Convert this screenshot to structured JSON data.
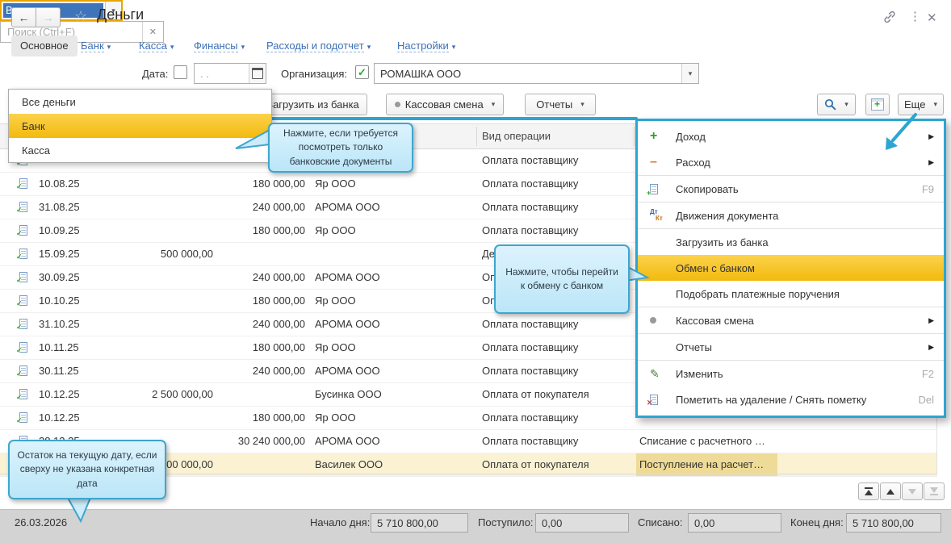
{
  "window": {
    "title": "Деньги"
  },
  "tabs": {
    "active": "Основное",
    "links": [
      "Банк",
      "Касса",
      "Финансы",
      "Расходы и подотчет",
      "Настройки"
    ]
  },
  "filters": {
    "money_value": "Все деньги",
    "date_label": "Дата:",
    "date_placeholder": ". .",
    "org_label": "Организация:",
    "org_value": "РОМАШКА ООО"
  },
  "toolbar": {
    "load_bank": "Загрузить из банка",
    "cash_shift": "Кассовая смена",
    "reports": "Отчеты",
    "search_placeholder": "Поиск (Ctrl+F)",
    "more": "Еще"
  },
  "dropdown": {
    "items": [
      {
        "label": "Все деньги",
        "highlighted": false
      },
      {
        "label": "Банк",
        "highlighted": true
      },
      {
        "label": "Касса",
        "highlighted": false
      }
    ]
  },
  "table": {
    "op_header": "Вид операции",
    "rows": [
      {
        "date": "",
        "income": "",
        "expense": "",
        "party": "",
        "op": "Оплата поставщику",
        "doc": "",
        "posted": true,
        "selected": false
      },
      {
        "date": "10.08.25",
        "income": "",
        "expense": "180 000,00",
        "party": "Яр ООО",
        "op": "Оплата поставщику",
        "doc": "",
        "posted": true,
        "selected": false
      },
      {
        "date": "31.08.25",
        "income": "",
        "expense": "240 000,00",
        "party": "АРОМА ООО",
        "op": "Оплата поставщику",
        "doc": "",
        "posted": true,
        "selected": false
      },
      {
        "date": "10.09.25",
        "income": "",
        "expense": "180 000,00",
        "party": "Яр ООО",
        "op": "Оплата поставщику",
        "doc": "",
        "posted": true,
        "selected": false
      },
      {
        "date": "15.09.25",
        "income": "500 000,00",
        "expense": "",
        "party": "",
        "op": "Де",
        "doc": "",
        "posted": true,
        "selected": false
      },
      {
        "date": "30.09.25",
        "income": "",
        "expense": "240 000,00",
        "party": "АРОМА ООО",
        "op": "Оплата поставщику",
        "doc": "",
        "posted": true,
        "selected": false
      },
      {
        "date": "10.10.25",
        "income": "",
        "expense": "180 000,00",
        "party": "Яр ООО",
        "op": "Оплата поставщику",
        "doc": "",
        "posted": true,
        "selected": false
      },
      {
        "date": "31.10.25",
        "income": "",
        "expense": "240 000,00",
        "party": "АРОМА ООО",
        "op": "Оплата поставщику",
        "doc": "",
        "posted": true,
        "selected": false
      },
      {
        "date": "10.11.25",
        "income": "",
        "expense": "180 000,00",
        "party": "Яр ООО",
        "op": "Оплата поставщику",
        "doc": "",
        "posted": true,
        "selected": false
      },
      {
        "date": "30.11.25",
        "income": "",
        "expense": "240 000,00",
        "party": "АРОМА ООО",
        "op": "Оплата поставщику",
        "doc": "",
        "posted": true,
        "selected": false
      },
      {
        "date": "10.12.25",
        "income": "2 500 000,00",
        "expense": "",
        "party": "Бусинка ООО",
        "op": "Оплата от покупателя",
        "doc": "",
        "posted": true,
        "selected": false
      },
      {
        "date": "10.12.25",
        "income": "",
        "expense": "180 000,00",
        "party": "Яр ООО",
        "op": "Оплата поставщику",
        "doc": "",
        "posted": true,
        "selected": false
      },
      {
        "date": "28.12.25",
        "income": "",
        "expense": "30 240 000,00",
        "party": "АРОМА ООО",
        "op": "Оплата поставщику",
        "doc": "Списание с расчетного …",
        "posted": true,
        "selected": false
      },
      {
        "date": "",
        "income": "700 000,00",
        "expense": "",
        "party": "Василек ООО",
        "op": "Оплата от покупателя",
        "doc": "Поступление на расчет…",
        "posted": false,
        "selected": true
      }
    ]
  },
  "more_menu": {
    "items": [
      {
        "label": "Доход",
        "icon": "plus-icon",
        "submenu": true
      },
      {
        "label": "Расход",
        "icon": "minus-icon",
        "submenu": true
      },
      {
        "sep": true
      },
      {
        "label": "Скопировать",
        "icon": "copy-icon",
        "shortcut": "F9"
      },
      {
        "sep": true
      },
      {
        "label": "Движения документа",
        "icon": "dtkt-icon"
      },
      {
        "sep": true
      },
      {
        "label": "Загрузить из банка"
      },
      {
        "label": "Обмен с банком",
        "highlighted": true
      },
      {
        "label": "Подобрать платежные поручения"
      },
      {
        "sep": true
      },
      {
        "label": "Кассовая смена",
        "icon": "dot-icon",
        "submenu": true
      },
      {
        "sep": true
      },
      {
        "label": "Отчеты",
        "submenu": true
      },
      {
        "sep": true
      },
      {
        "label": "Изменить",
        "icon": "pencil-icon",
        "shortcut": "F2"
      },
      {
        "label": "Пометить на удаление / Снять пометку",
        "icon": "delete-icon",
        "shortcut": "Del"
      }
    ]
  },
  "tooltips": [
    {
      "text": "Нажмите, если требуется посмотреть только банковские документы"
    },
    {
      "text": "Нажмите, чтобы перейти к обмену с банком"
    },
    {
      "text": "Остаток на текущую дату, если сверху не указана конкретная дата"
    }
  ],
  "footer": {
    "date": "26.03.2026",
    "fields": [
      {
        "label": "Начало дня:",
        "value": "5 710 800,00"
      },
      {
        "label": "Поступило:",
        "value": "0,00"
      },
      {
        "label": "Списано:",
        "value": "0,00"
      },
      {
        "label": "Конец дня:",
        "value": "5 710 800,00"
      }
    ]
  },
  "colors": {
    "accent_teal": "#2CA5D1",
    "highlight_yellow": "#F2BA0E",
    "selected_row": "#FBF2D4",
    "combo_focus_border": "#E9A400",
    "link_blue": "#3B70B5"
  }
}
